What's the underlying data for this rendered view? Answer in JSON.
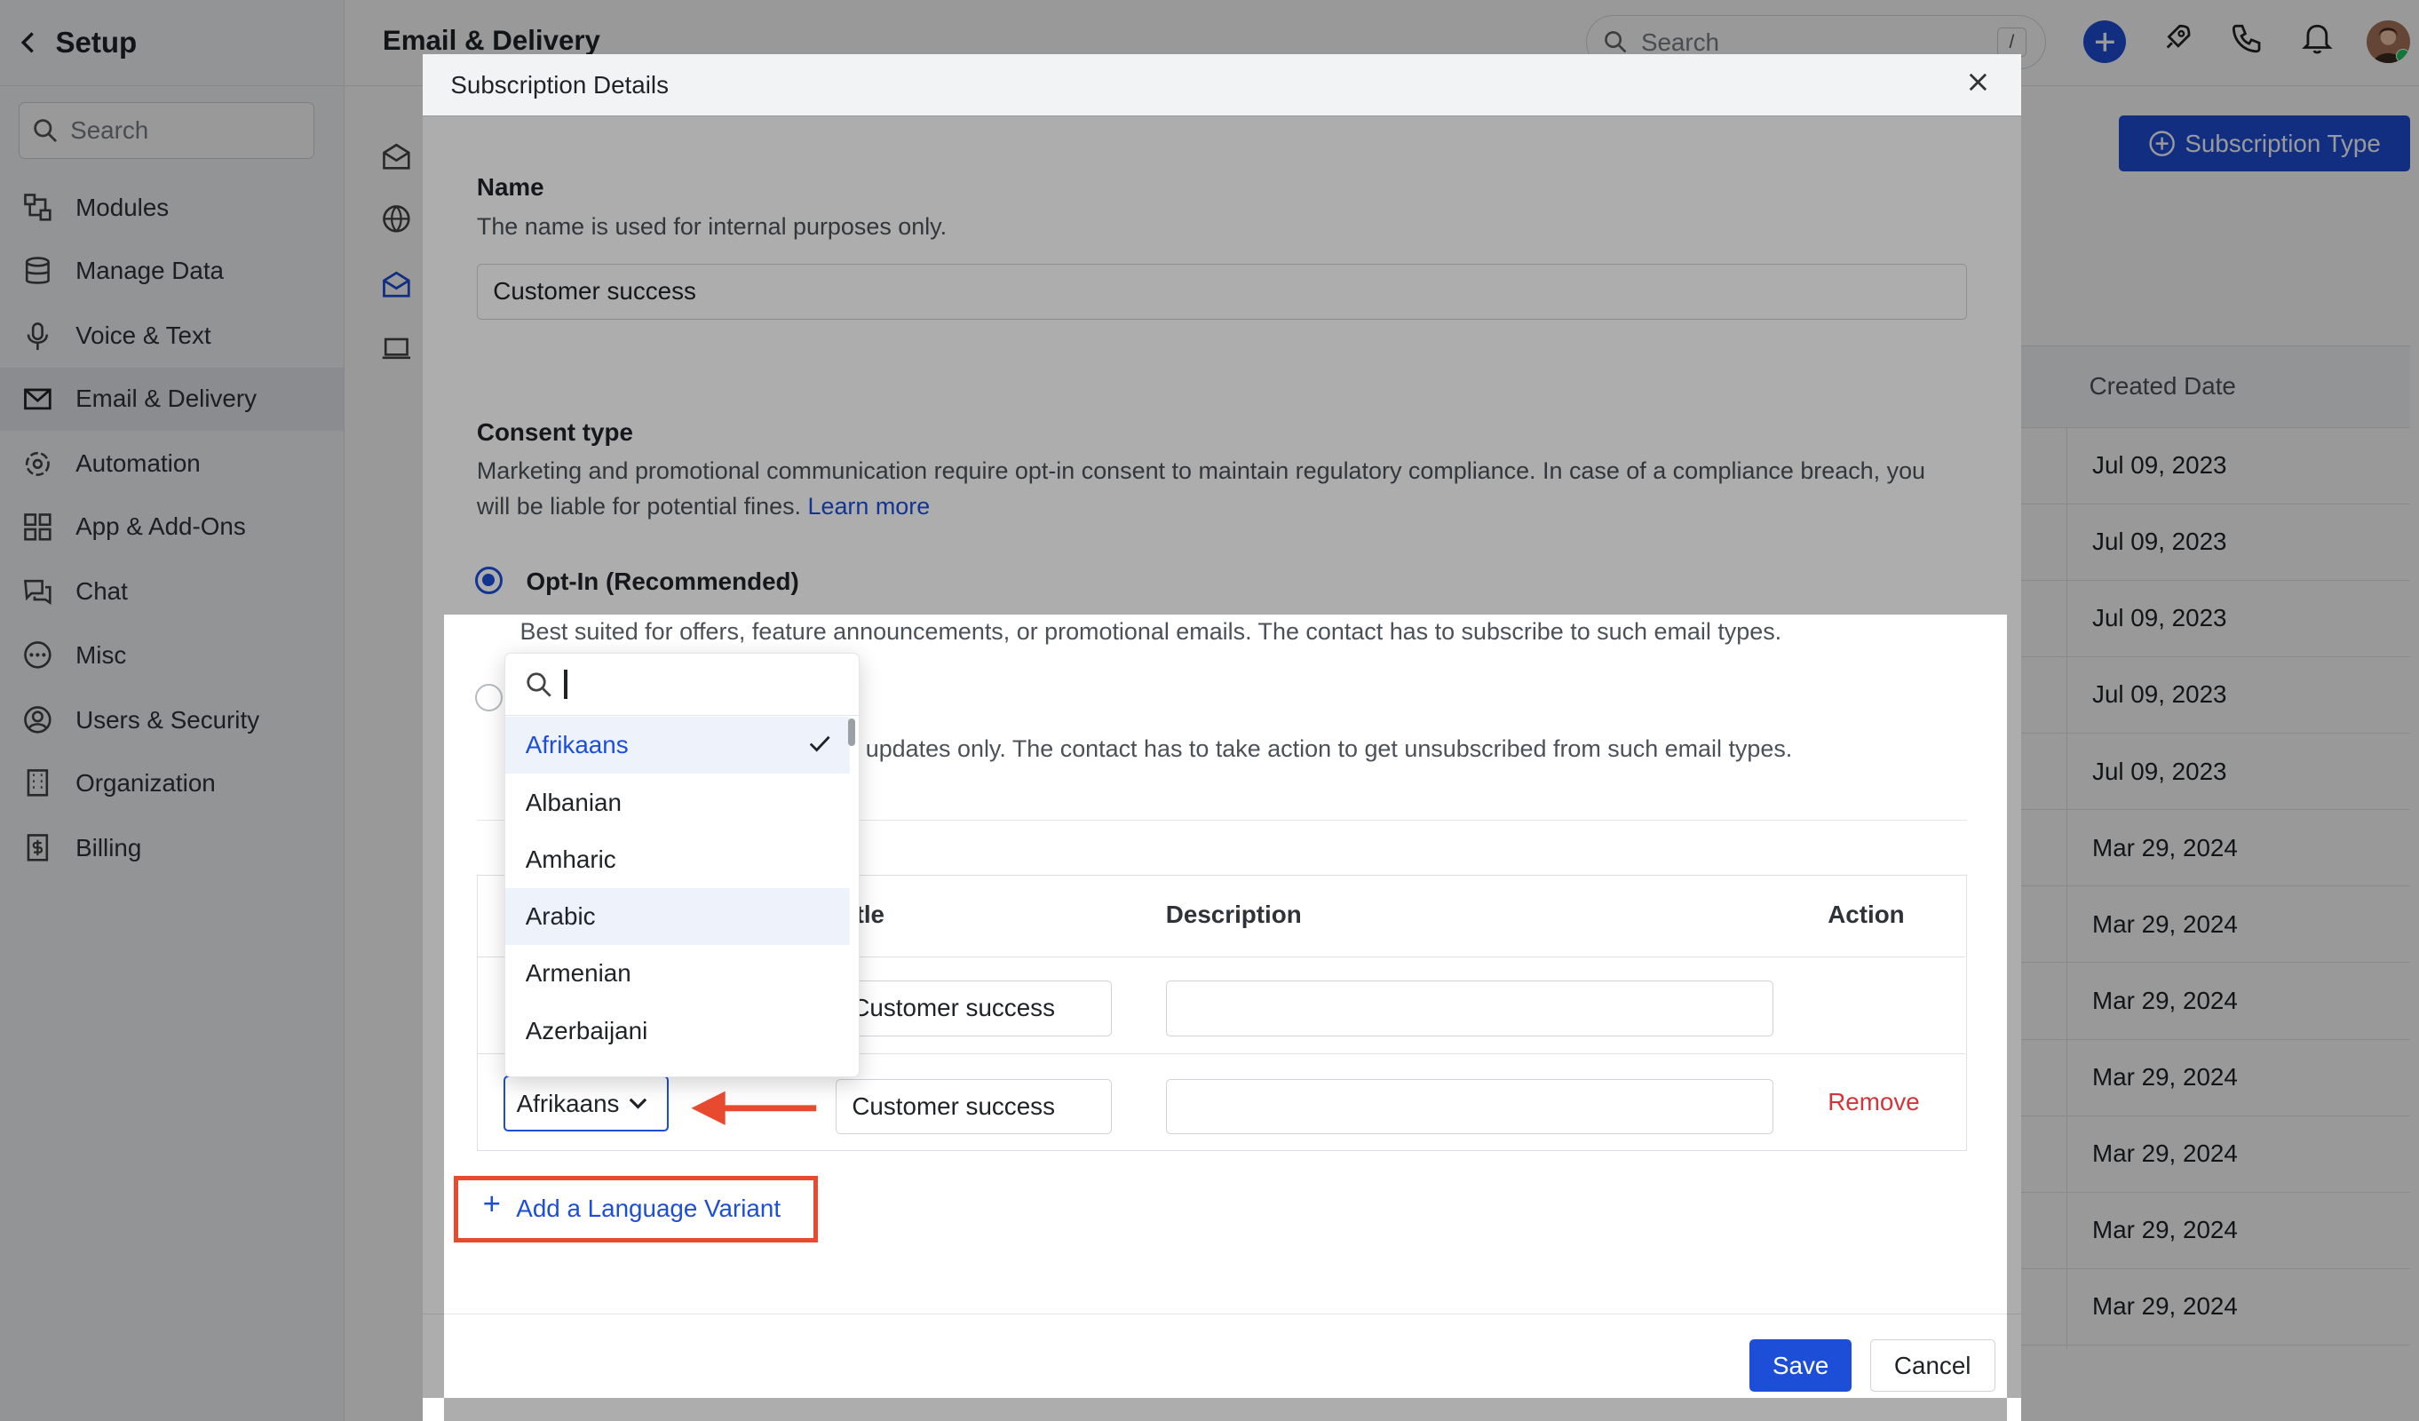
{
  "sidebar": {
    "title": "Setup",
    "search_placeholder": "Search",
    "items": [
      {
        "label": "Modules"
      },
      {
        "label": "Manage Data"
      },
      {
        "label": "Voice & Text"
      },
      {
        "label": "Email & Delivery"
      },
      {
        "label": "Automation"
      },
      {
        "label": "App & Add-Ons"
      },
      {
        "label": "Chat"
      },
      {
        "label": "Misc"
      },
      {
        "label": "Users & Security"
      },
      {
        "label": "Organization"
      },
      {
        "label": "Billing"
      }
    ],
    "active_item": "Email & Delivery"
  },
  "header": {
    "page_title": "Email & Delivery",
    "search_placeholder": "Search",
    "search_shortcut": "/"
  },
  "background": {
    "subscription_type_button": "Subscription Type",
    "table_header": "Created Date",
    "created_dates": [
      "Jul 09, 2023",
      "Jul 09, 2023",
      "Jul 09, 2023",
      "Jul 09, 2023",
      "Jul 09, 2023",
      "Mar 29, 2024",
      "Mar 29, 2024",
      "Mar 29, 2024",
      "Mar 29, 2024",
      "Mar 29, 2024",
      "Mar 29, 2024",
      "Mar 29, 2024"
    ]
  },
  "modal": {
    "title": "Subscription Details",
    "name_label": "Name",
    "name_help": "The name is used for internal purposes only.",
    "name_value": "Customer success",
    "consent_label": "Consent type",
    "consent_help": "Marketing and promotional communication require opt-in consent to maintain regulatory compliance. In case of a compliance breach, you will be liable for potential fines.",
    "learn_more": "Learn more",
    "optin_label": "Opt-In (Recommended)",
    "optin_desc": "Best suited for offers, feature announcements, or promotional emails. The contact has to subscribe to such email types.",
    "optout_desc_partial": "updates only. The contact has to take action to get unsubscribed from such email types.",
    "table": {
      "col_title_partial": "tle",
      "col_description": "Description",
      "col_action": "Action",
      "rows": [
        {
          "title": "Customer success",
          "description": ""
        },
        {
          "language": "Afrikaans",
          "title": "Customer success",
          "description": "",
          "action": "Remove"
        }
      ]
    },
    "add_variant": "Add a Language Variant",
    "save": "Save",
    "cancel": "Cancel"
  },
  "dropdown": {
    "search_value": "",
    "options": [
      "Afrikaans",
      "Albanian",
      "Amharic",
      "Arabic",
      "Armenian",
      "Azerbaijani"
    ],
    "selected": "Afrikaans",
    "hovered": "Arabic"
  },
  "colors": {
    "accent": "#1d4ed8",
    "danger": "#d4353a",
    "highlight": "#e84a2f"
  }
}
